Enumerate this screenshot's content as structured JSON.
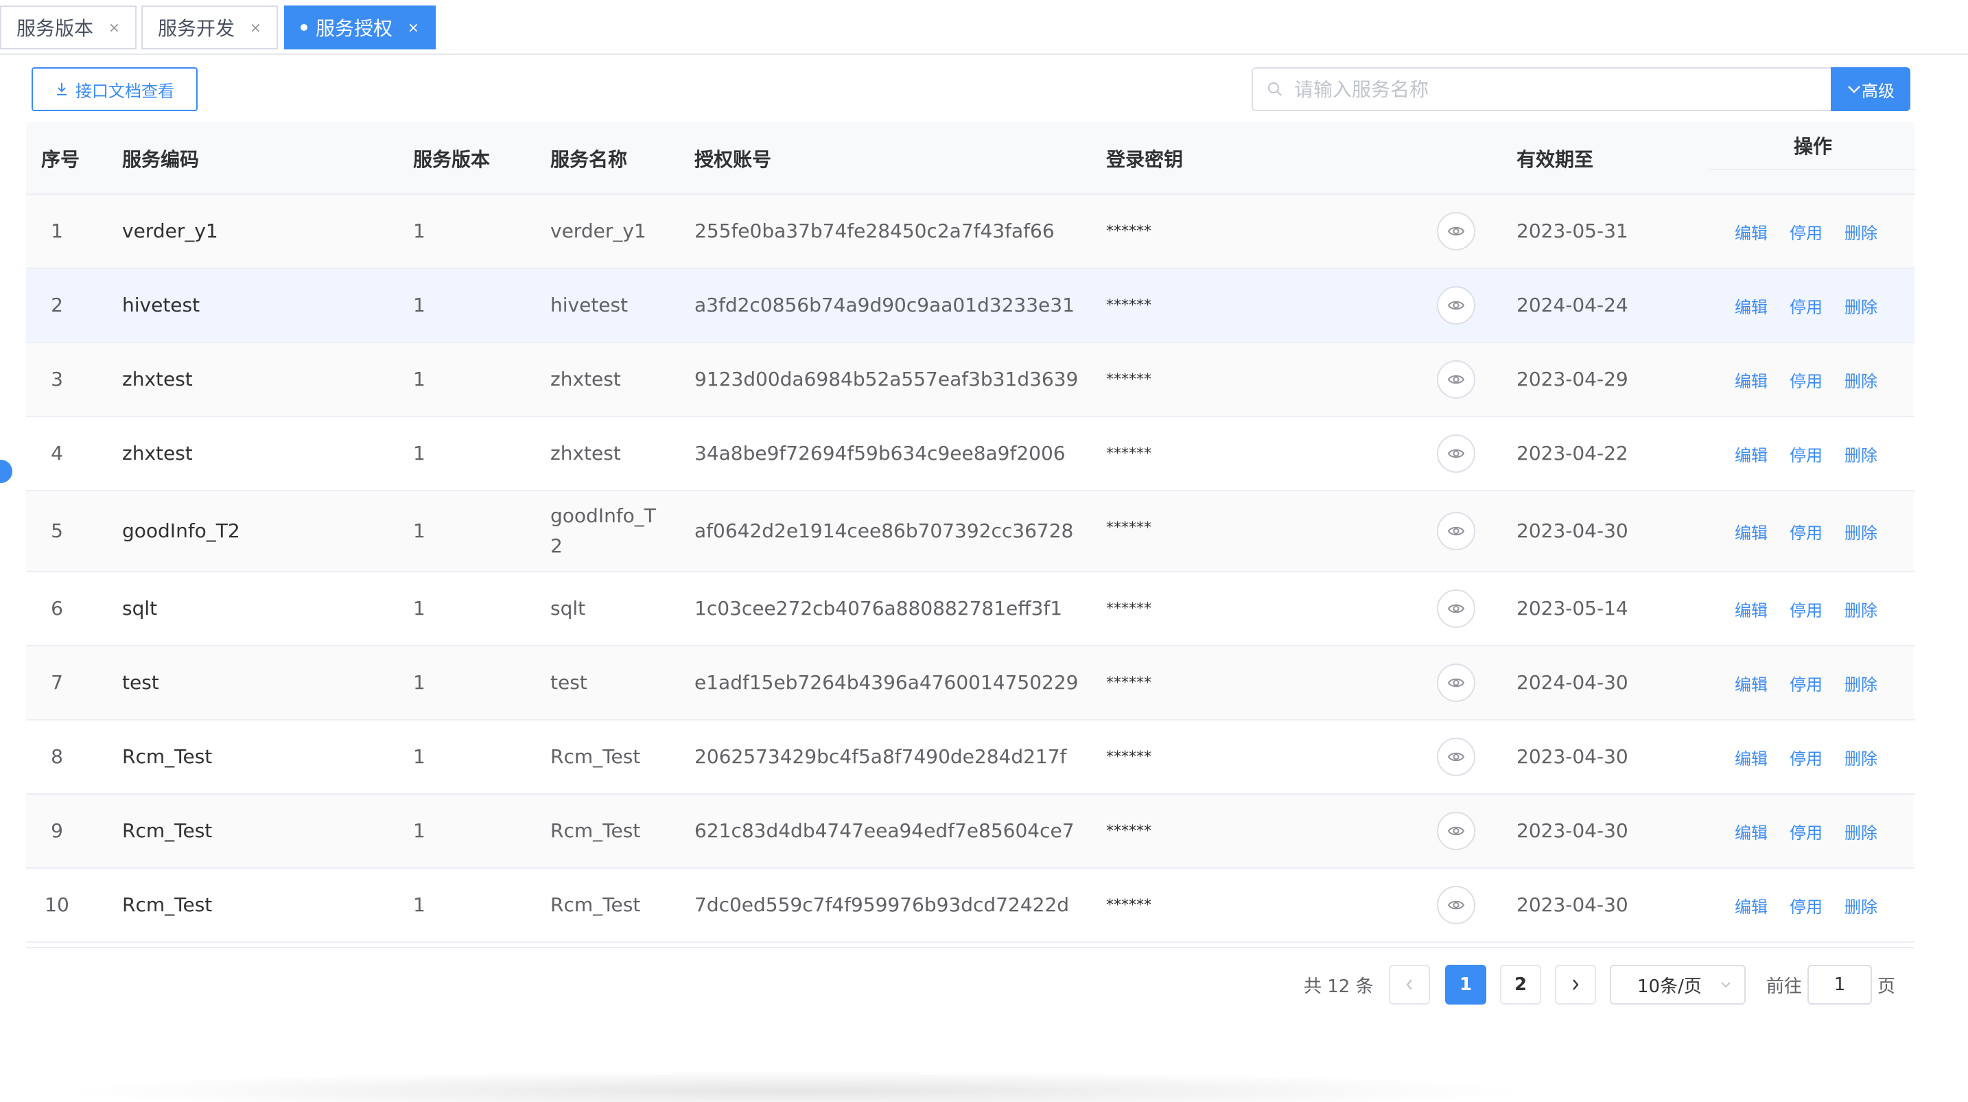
{
  "tabs": [
    {
      "label": "服务版本",
      "close": "×",
      "active": false
    },
    {
      "label": "服务开发",
      "close": "×",
      "active": false
    },
    {
      "label": "服务授权",
      "close": "×",
      "active": true
    }
  ],
  "toolbar": {
    "doc_button_label": "接口文档查看",
    "search_placeholder": "请输入服务名称",
    "search_value": "",
    "advanced_label": "高级"
  },
  "table": {
    "headers": {
      "index": "序号",
      "code": "服务编码",
      "version": "服务版本",
      "name": "服务名称",
      "account": "授权账号",
      "secret": "登录密钥",
      "expires": "有效期至",
      "ops": "操作"
    },
    "action_labels": {
      "edit": "编辑",
      "disable": "停用",
      "delete": "删除"
    },
    "rows": [
      {
        "index": "1",
        "code": "verder_y1",
        "version": "1",
        "name": "verder_y1",
        "account": "255fe0ba37b74fe28450c2a7f43faf66",
        "secret": "******",
        "expires": "2023-05-31"
      },
      {
        "index": "2",
        "code": "hivetest",
        "version": "1",
        "name": "hivetest",
        "account": "a3fd2c0856b74a9d90c9aa01d3233e31",
        "secret": "******",
        "expires": "2024-04-24"
      },
      {
        "index": "3",
        "code": "zhxtest",
        "version": "1",
        "name": "zhxtest",
        "account": "9123d00da6984b52a557eaf3b31d3639",
        "secret": "******",
        "expires": "2023-04-29"
      },
      {
        "index": "4",
        "code": "zhxtest",
        "version": "1",
        "name": "zhxtest",
        "account": "34a8be9f72694f59b634c9ee8a9f2006",
        "secret": "******",
        "expires": "2023-04-22"
      },
      {
        "index": "5",
        "code": "goodInfo_T2",
        "version": "1",
        "name_line1": "goodInfo_T",
        "name_line2": "2",
        "account": "af0642d2e1914cee86b707392cc36728",
        "secret": "******",
        "expires": "2023-04-30"
      },
      {
        "index": "6",
        "code": "sqlt",
        "version": "1",
        "name": "sqlt",
        "account": "1c03cee272cb4076a880882781eff3f1",
        "secret": "******",
        "expires": "2023-05-14"
      },
      {
        "index": "7",
        "code": "test",
        "version": "1",
        "name": "test",
        "account": "e1adf15eb7264b4396a4760014750229",
        "secret": "******",
        "expires": "2024-04-30"
      },
      {
        "index": "8",
        "code": "Rcm_Test",
        "version": "1",
        "name": "Rcm_Test",
        "account": "2062573429bc4f5a8f7490de284d217f",
        "secret": "******",
        "expires": "2023-04-30"
      },
      {
        "index": "9",
        "code": "Rcm_Test",
        "version": "1",
        "name": "Rcm_Test",
        "account": "621c83d4db4747eea94edf7e85604ce7",
        "secret": "******",
        "expires": "2023-04-30"
      },
      {
        "index": "10",
        "code": "Rcm_Test",
        "version": "1",
        "name": "Rcm_Test",
        "account": "7dc0ed559c7f4f959976b93dcd72422d",
        "secret": "******",
        "expires": "2023-04-30"
      }
    ]
  },
  "pagination": {
    "total_text": "共 12 条",
    "prev": "<",
    "pages": [
      "1",
      "2"
    ],
    "current_page": "1",
    "next": ">",
    "page_size": "10条/页",
    "goto_label": "前往",
    "goto_value": "1",
    "goto_suffix": "页"
  },
  "colors": {
    "primary": "#3b8cf3",
    "border": "#ebeef5",
    "hover_row": "#f0f5ff"
  }
}
